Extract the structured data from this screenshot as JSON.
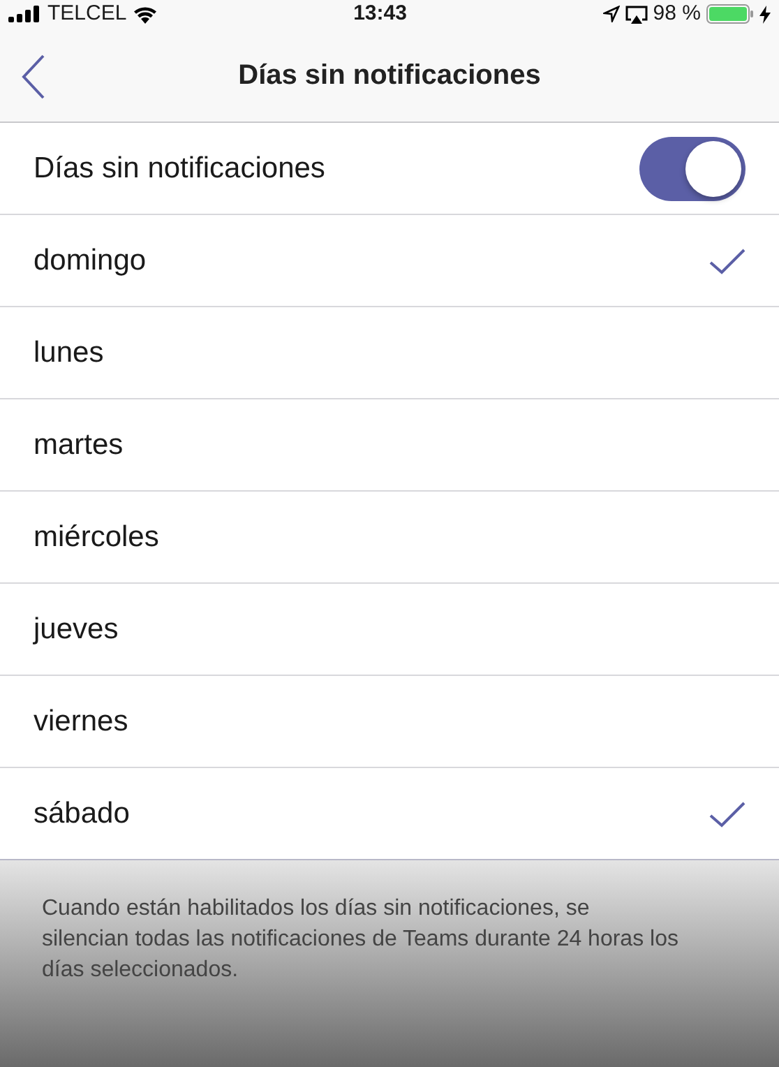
{
  "status_bar": {
    "carrier": "TELCEL",
    "time": "13:43",
    "battery": "98 %"
  },
  "nav": {
    "title": "Días sin notificaciones"
  },
  "toggle": {
    "label": "Días sin notificaciones",
    "on": true
  },
  "days": [
    {
      "label": "domingo",
      "selected": true
    },
    {
      "label": "lunes",
      "selected": false
    },
    {
      "label": "martes",
      "selected": false
    },
    {
      "label": "miércoles",
      "selected": false
    },
    {
      "label": "jueves",
      "selected": false
    },
    {
      "label": "viernes",
      "selected": false
    },
    {
      "label": "sábado",
      "selected": true
    }
  ],
  "footer_note": "Cuando están habilitados los días sin notificaciones, se silencian todas las notificaciones de Teams durante 24 horas los días seleccionados."
}
